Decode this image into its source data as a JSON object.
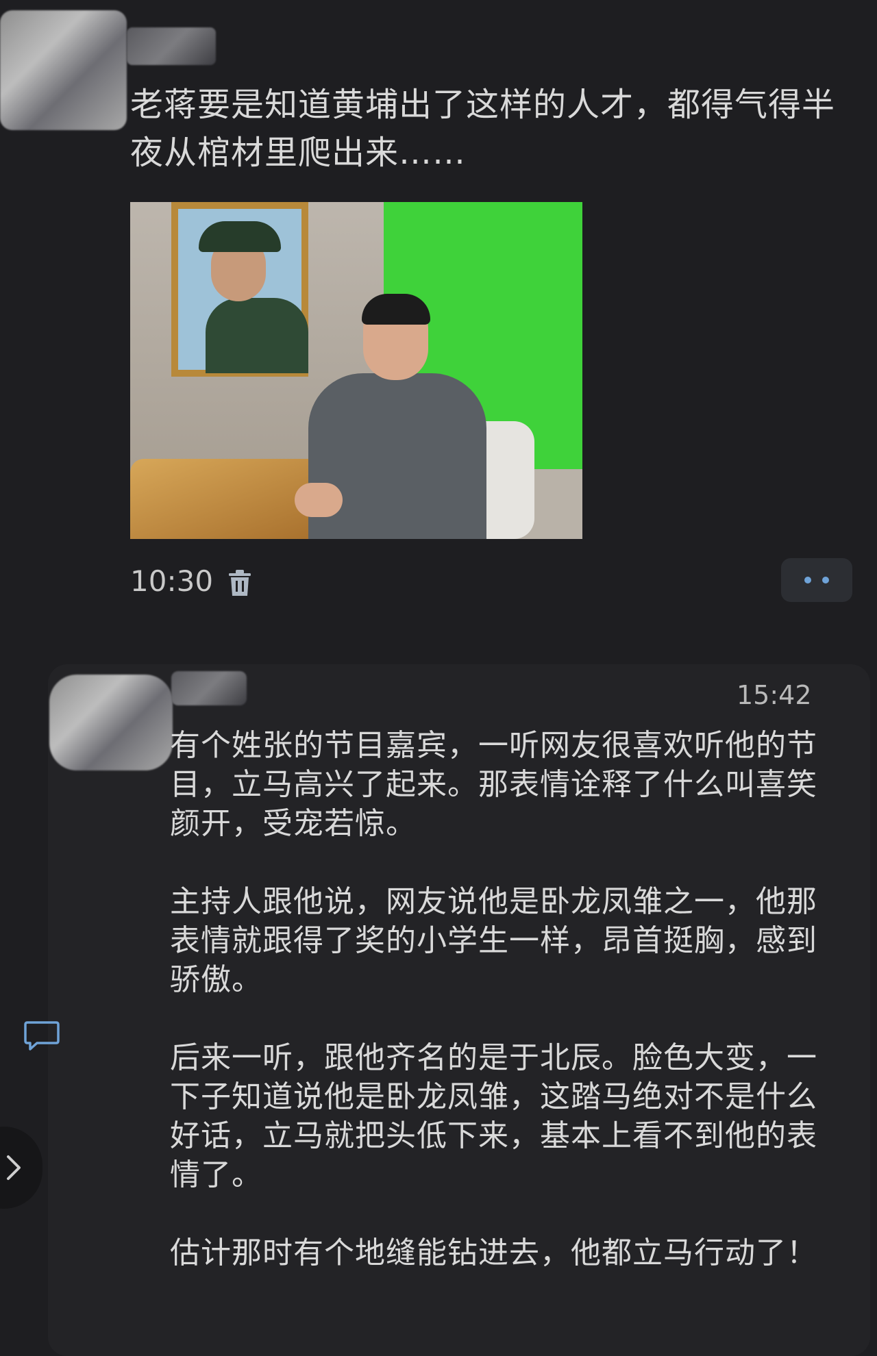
{
  "message1": {
    "text": "老蒋要是知道黄埔出了这样的人才，都得气得半夜从棺材里爬出来……",
    "time": "10:30"
  },
  "message2": {
    "time": "15:42",
    "paragraphs": [
      "有个姓张的节目嘉宾，一听网友很喜欢听他的节目，立马高兴了起来。那表情诠释了什么叫喜笑颜开，受宠若惊。",
      "主持人跟他说，网友说他是卧龙凤雏之一，他那表情就跟得了奖的小学生一样，昂首挺胸，感到骄傲。",
      "后来一听，跟他齐名的是于北辰。脸色大变，一下子知道说他是卧龙凤雏，这踏马绝对不是什么好话，立马就把头低下来，基本上看不到他的表情了。",
      "估计那时有个地缝能钻进去，他都立马行动了！"
    ]
  },
  "icons": {
    "trash": "trash-icon",
    "more": "more-dots-icon",
    "comment": "comment-icon",
    "expand": "chevron-right-icon"
  },
  "colors": {
    "background": "#1e1e21",
    "accent": "#6fa3d8"
  }
}
